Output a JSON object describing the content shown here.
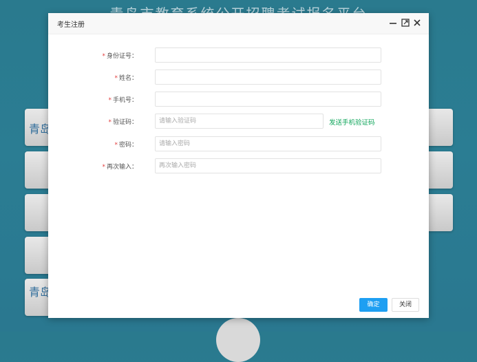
{
  "background": {
    "title": "青岛市教育系统公开招聘考试报名平台",
    "cards_left": [
      {
        "text": "青岛"
      },
      {
        "text": ""
      },
      {
        "text": ""
      },
      {
        "text": ""
      },
      {
        "text": "青岛"
      }
    ],
    "cards_right": [
      {
        "text": ""
      },
      {
        "text": ""
      },
      {
        "text": ""
      }
    ]
  },
  "dialog": {
    "title": "考生注册",
    "header_icons": [
      "minimize-icon",
      "maximize-icon",
      "close-icon"
    ]
  },
  "form": {
    "required_mark": "*",
    "id_number": {
      "label": "身份证号：",
      "value": "",
      "placeholder": ""
    },
    "name": {
      "label": "姓名：",
      "value": "",
      "placeholder": ""
    },
    "phone": {
      "label": "手机号：",
      "value": "",
      "placeholder": ""
    },
    "verify_code": {
      "label": "验证码：",
      "value": "",
      "placeholder": "请输入验证码",
      "send_label": "发送手机验证码"
    },
    "password": {
      "label": "密码：",
      "value": "",
      "placeholder": "请输入密码"
    },
    "password_confirm": {
      "label": "再次输入：",
      "value": "",
      "placeholder": "再次输入密码"
    }
  },
  "buttons": {
    "ok": "确定",
    "close": "关闭"
  },
  "colors": {
    "background": "#2a7a8e",
    "primary_button": "#1e9ff2",
    "link_green": "#0ea55a",
    "required_red": "#e23c3c"
  }
}
